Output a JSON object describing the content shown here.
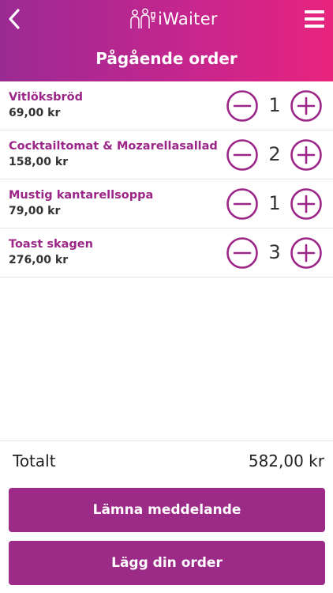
{
  "header": {
    "app_name": "iWaiter",
    "title": "Pågående order",
    "back_icon": "chevron-left-icon",
    "menu_icon": "hamburger-menu-icon",
    "logo_icon": "waiters-logo-icon"
  },
  "colors": {
    "header_gradient_start": "#9b2a93",
    "header_gradient_end": "#e8237e",
    "accent": "#9c2588",
    "button": "#9c2a87"
  },
  "order": {
    "items": [
      {
        "name": "Vitlöksbröd",
        "price": "69,00 kr",
        "quantity": "1"
      },
      {
        "name": "Cocktailtomat & Mozarellasallad",
        "price": "158,00 kr",
        "quantity": "2"
      },
      {
        "name": "Mustig kantarellsoppa",
        "price": "79,00 kr",
        "quantity": "1"
      },
      {
        "name": "Toast skagen",
        "price": "276,00 kr",
        "quantity": "3"
      }
    ],
    "minus_icon": "minus-circle-icon",
    "plus_icon": "plus-circle-icon"
  },
  "summary": {
    "total_label": "Totalt",
    "total_value": "582,00 kr"
  },
  "actions": {
    "message_label": "Lämna meddelande",
    "order_label": "Lägg din order"
  }
}
